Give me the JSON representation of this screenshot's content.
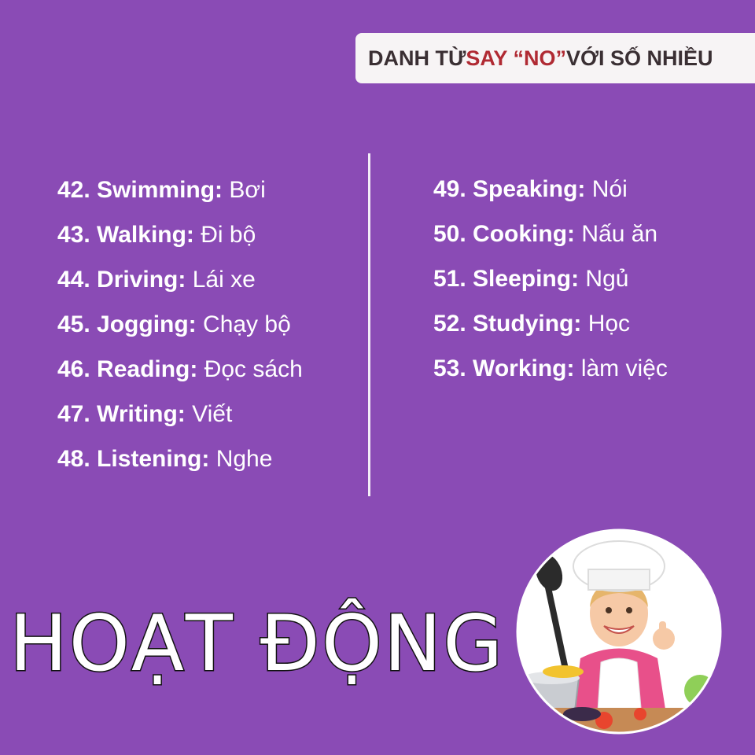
{
  "header": {
    "title_part1": "DANH TỪ ",
    "title_highlight": "SAY “NO”",
    "title_part2": " VỚI SỐ NHIỀU",
    "highlight_color": "#b02a33"
  },
  "left_list": [
    {
      "term": "42. Swimming:",
      "meaning": " Bơi"
    },
    {
      "term": "43. Walking:",
      "meaning": " Đi bộ"
    },
    {
      "term": "44. Driving:",
      "meaning": " Lái xe"
    },
    {
      "term": "45. Jogging:",
      "meaning": " Chạy bộ"
    },
    {
      "term": "46. Reading:",
      "meaning": " Đọc sách"
    },
    {
      "term": "47. Writing:",
      "meaning": " Viết"
    },
    {
      "term": "48. Listening:",
      "meaning": " Nghe"
    }
  ],
  "right_list": [
    {
      "term": "49. Speaking:",
      "meaning": " Nói"
    },
    {
      "term": "50. Cooking:",
      "meaning": " Nấu ăn"
    },
    {
      "term": "51. Sleeping:",
      "meaning": " Ngủ"
    },
    {
      "term": "52. Studying:",
      "meaning": " Học"
    },
    {
      "term": "53. Working:",
      "meaning": " làm việc"
    }
  ],
  "footer": {
    "big_title": "HOẠT ĐỘNG"
  },
  "photo": {
    "icon": "child-chef-photo",
    "background_color": "#8a4bb5"
  }
}
